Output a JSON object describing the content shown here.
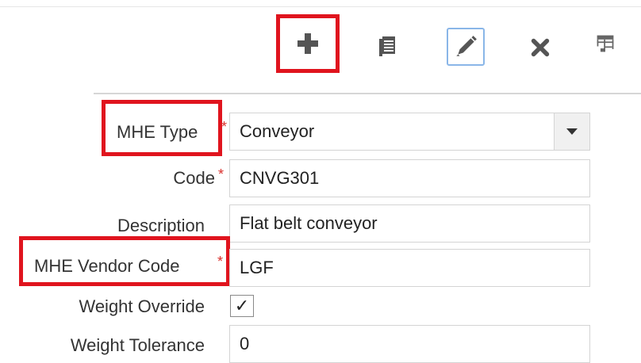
{
  "toolbar": {
    "icons": [
      "plus-icon",
      "details-icon",
      "pencil-icon",
      "close-icon",
      "grid-icon"
    ]
  },
  "form": {
    "mhe_type": {
      "label": "MHE Type",
      "value": "Conveyor",
      "required_mark": "*"
    },
    "code": {
      "label": "Code",
      "value": "CNVG301",
      "required_mark": "*"
    },
    "description": {
      "label": "Description",
      "value": "Flat belt conveyor"
    },
    "mhe_vendor_code": {
      "label": "MHE Vendor Code",
      "value": "LGF",
      "required_mark": "*"
    },
    "weight_override": {
      "label": "Weight Override",
      "checked": true,
      "check_glyph": "✓"
    },
    "weight_tolerance": {
      "label": "Weight Tolerance",
      "value": "0"
    }
  },
  "colors": {
    "highlight": "#e0141e",
    "required": "#d9302c",
    "edit_border": "#8ab6e8",
    "icon": "#555555"
  }
}
